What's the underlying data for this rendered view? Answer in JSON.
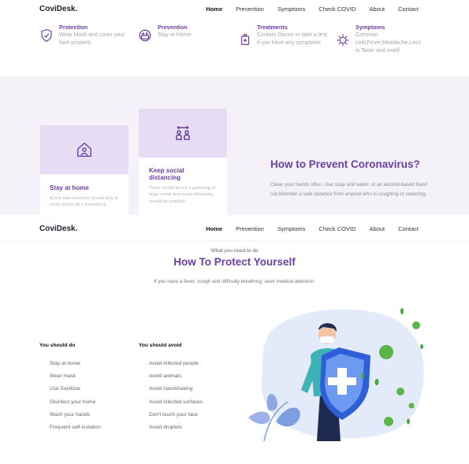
{
  "nav": {
    "brand": "CoviDesk.",
    "links": [
      "Home",
      "Prevention",
      "Symptoms",
      "Check COVID",
      "About",
      "Contact"
    ]
  },
  "features": [
    {
      "icon": "shield-check-icon",
      "title": "Protection",
      "text": "Wear Mask and cover your face properly"
    },
    {
      "icon": "face-mask-icon",
      "title": "Prevention",
      "text": "Stay at Home"
    },
    {
      "icon": "sanitizer-icon",
      "title": "Treatments",
      "text": "Contact Doctor or take a test if you have any symptoms"
    },
    {
      "icon": "virus-icon",
      "title": "Symptoms",
      "text": "Common cold,Fever,Headache,Loss in Taste and smell"
    }
  ],
  "cards": [
    {
      "icon": "home-person-icon",
      "title": "Stay at home",
      "text": "At this time everyone should stay at home unless its a emergency"
    },
    {
      "icon": "social-distance-icon",
      "title": "Keep social distancing",
      "text": "There should be not a gathering of huge crowd and social distancing should be maintain"
    }
  ],
  "prevent": {
    "title": "How to Prevent Coronavirus?",
    "text": "Clean your hands often. Use soap and water, or an alcohol-based hand rub.Maintain a safe distance from anyone who is coughing or sneezing."
  },
  "protect": {
    "subtitle": "What you need to do",
    "title": "How To Protect Yourself",
    "description": "If you have a fever, cough and difficulty breathing, seek medical attention."
  },
  "do": {
    "heading": "You should do",
    "items": [
      "Stay at home",
      "Wear mask",
      "Use Sanitizer",
      "Disinfect your home",
      "Wash your hands",
      "Frequent self-isolation"
    ]
  },
  "avoid": {
    "heading": "You should avoid",
    "items": [
      "Avoid infected people",
      "Avoid animals",
      "Avoid handshaking",
      "Avoid infected surfaces",
      "Don't touch your face",
      "Avoid droplets"
    ]
  },
  "colors": {
    "accent": "#6b3fa0",
    "band": "#f4f2f8",
    "card_top": "#e6dcf3",
    "virus": "#5bb548"
  }
}
